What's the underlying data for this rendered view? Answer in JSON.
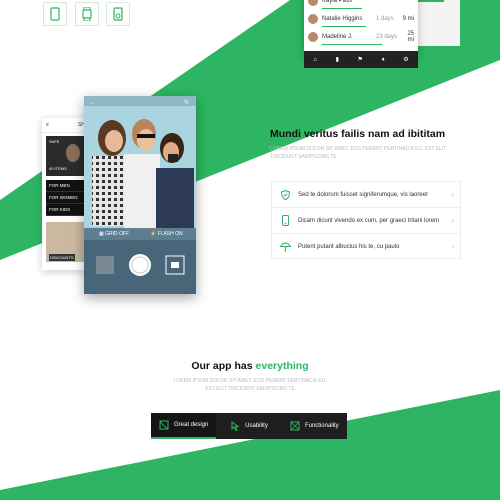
{
  "colors": {
    "accent": "#2db563",
    "dark": "#1e1e1e"
  },
  "top_icons": [
    "phone-icon",
    "watch-icon",
    "ipod-icon"
  ],
  "stats": {
    "rows": [
      {
        "name": "Kayla Pass",
        "days": "",
        "km": "",
        "progress": 0.5
      },
      {
        "name": "Natalie Higgins",
        "days": "1 days",
        "km": "9 mi",
        "progress": 0.55
      },
      {
        "name": "Madeline J.",
        "days": "23 days",
        "km": "25 mi",
        "progress": 0.75
      }
    ]
  },
  "phone_main": {
    "grid_label": "GRID OFF",
    "flash_label": "FLASH ON"
  },
  "phone_back": {
    "menu": [
      "FOR MEN",
      "FOR WOMEN",
      "FOR KIDS"
    ],
    "header_label": "SH",
    "card1": "SAFE",
    "card2": "40 ITEMS",
    "footer": "DISCOUNTS"
  },
  "section1": {
    "title": "Mundi veritus failis nam ad ibititam",
    "subtitle": "LOREM IPSUM DOLOR SIT AMET, EOS PERENT PERTINACIA EU. EST ELIT TINCIDUNT SADIPSCING TE",
    "features": [
      {
        "icon": "shield-icon",
        "text": "Sed te dolorum fuisset signiferumque, vis laoreet"
      },
      {
        "icon": "mobile-icon",
        "text": "Dicam dicunt vivendo ex cum, per graeci tritani lorem"
      },
      {
        "icon": "umbrella-icon",
        "text": "Putent putant albucius his te, cu paulo"
      }
    ]
  },
  "section2": {
    "title_prefix": "Our app has",
    "title_accent": "everything",
    "subtitle": "LOREM IPSUM DOLOR SIT AMET, EOS PERENT PERTINACIA EU. EST ELIT TINCIDUNT SADIPSCING TE",
    "tabs": [
      {
        "label": "Great design",
        "icon": "design-icon"
      },
      {
        "label": "Usability",
        "icon": "cursor-icon"
      },
      {
        "label": "Functionality",
        "icon": "functionality-icon"
      }
    ]
  }
}
